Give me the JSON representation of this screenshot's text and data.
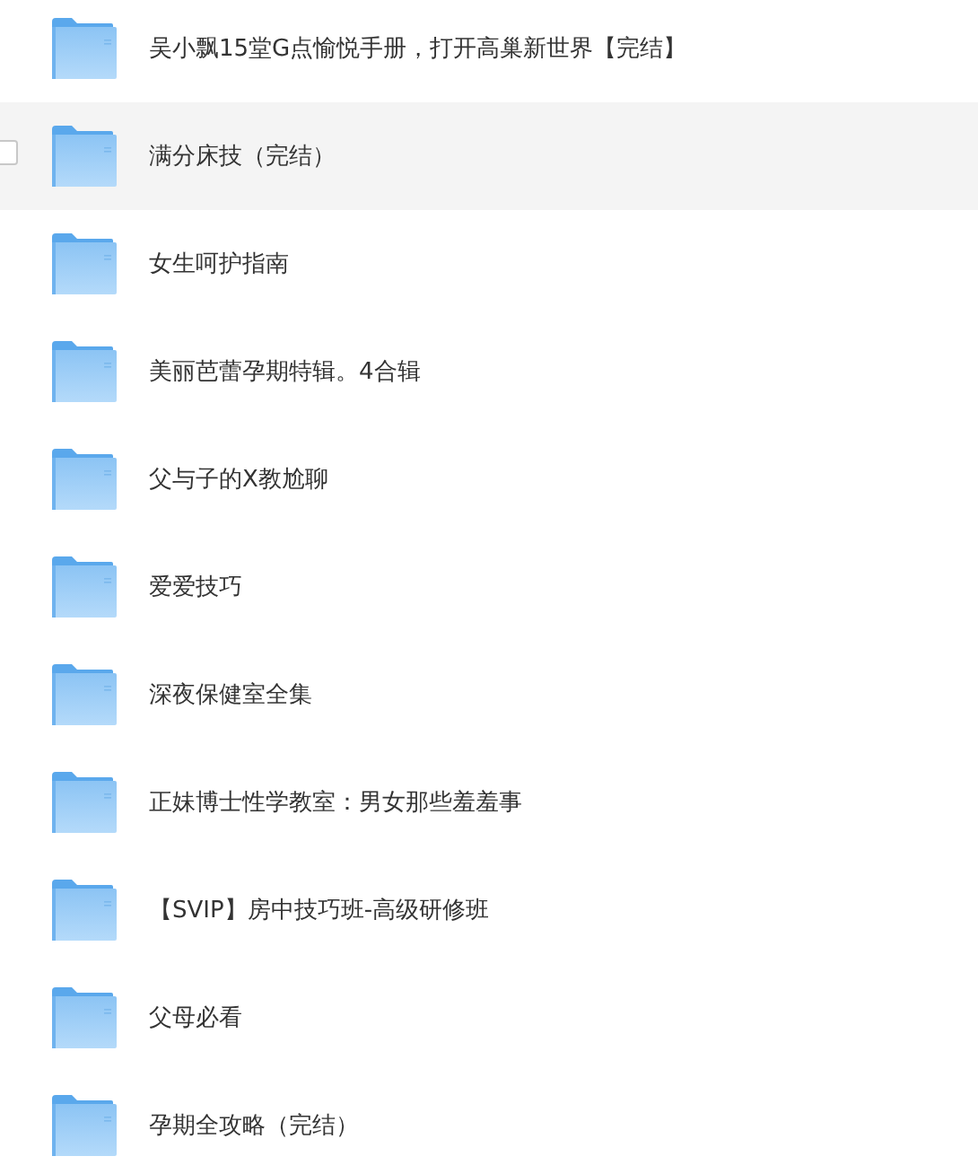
{
  "folders": [
    {
      "name": "吴小飘15堂G点愉悦手册，打开高巢新世界【完结】",
      "hovered": false,
      "checked": false
    },
    {
      "name": "满分床技（完结）",
      "hovered": true,
      "checked": false
    },
    {
      "name": "女生呵护指南",
      "hovered": false,
      "checked": false
    },
    {
      "name": "美丽芭蕾孕期特辑。4合辑",
      "hovered": false,
      "checked": false
    },
    {
      "name": "父与子的X教尬聊",
      "hovered": false,
      "checked": false
    },
    {
      "name": "爱爱技巧",
      "hovered": false,
      "checked": false
    },
    {
      "name": "深夜保健室全集",
      "hovered": false,
      "checked": false
    },
    {
      "name": "正妹博士性学教室：男女那些羞羞事",
      "hovered": false,
      "checked": false
    },
    {
      "name": "【SVIP】房中技巧班-高级研修班",
      "hovered": false,
      "checked": false
    },
    {
      "name": "父母必看",
      "hovered": false,
      "checked": false
    },
    {
      "name": "孕期全攻略（完结）",
      "hovered": false,
      "checked": false
    }
  ]
}
